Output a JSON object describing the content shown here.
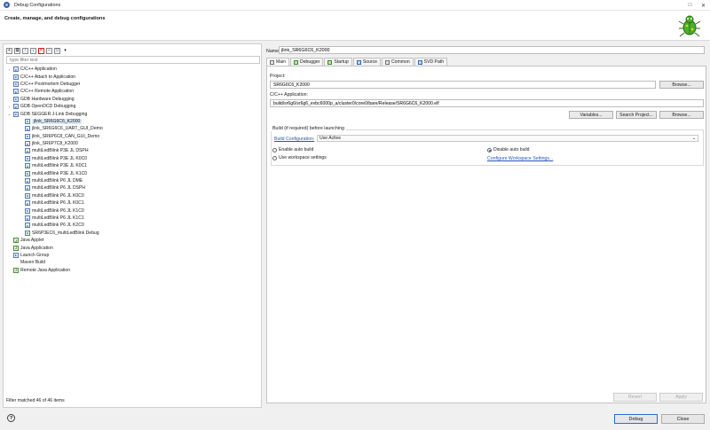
{
  "window": {
    "title": "Debug Configurations",
    "controls": [
      "□",
      "✕"
    ]
  },
  "banner": {
    "title": "Create, manage, and debug configurations"
  },
  "left": {
    "filter_placeholder": "type filter text",
    "status": "Filter matched 46 of 46 items",
    "toolbar": [
      "new-config-icon",
      "duplicate-icon",
      "export-icon",
      "import-icon",
      "delete-icon",
      "collapse-all-icon",
      "filter-icon",
      "dropdown-icon"
    ],
    "tree": [
      {
        "label": "C/C++ Application",
        "level": 0,
        "twist": "›",
        "icon": "c-icon"
      },
      {
        "label": "C/C++ Attach to Application",
        "level": 0,
        "twist": "",
        "icon": "c-icon"
      },
      {
        "label": "C/C++ Postmortem Debugger",
        "level": 0,
        "twist": "",
        "icon": "c-icon"
      },
      {
        "label": "C/C++ Remote Application",
        "level": 0,
        "twist": "",
        "icon": "c-icon"
      },
      {
        "label": "GDB Hardware Debugging",
        "level": 0,
        "twist": "",
        "icon": "c-icon"
      },
      {
        "label": "GDB OpenOCD Debugging",
        "level": 0,
        "twist": "›",
        "icon": "c-icon"
      },
      {
        "label": "GDB SEGGER J-Link Debugging",
        "level": 0,
        "twist": "⌄",
        "icon": "c-icon"
      },
      {
        "label": "jlink_SR6G6C6_K2000",
        "level": 1,
        "twist": "",
        "icon": "c-icon",
        "selected": true
      },
      {
        "label": "jlink_SR6G6C6_UART_GUI_Demo",
        "level": 1,
        "twist": "",
        "icon": "c-icon"
      },
      {
        "label": "jlink_SR6P6C8_CAN_GUI_Demo",
        "level": 1,
        "twist": "",
        "icon": "c-icon"
      },
      {
        "label": "jlink_SR6P7C8_K2000",
        "level": 1,
        "twist": "",
        "icon": "c-icon"
      },
      {
        "label": "multiLedBlink P3E JL DSPH",
        "level": 1,
        "twist": "",
        "icon": "c-icon"
      },
      {
        "label": "multiLedBlink P3E JL K0C0",
        "level": 1,
        "twist": "",
        "icon": "c-icon"
      },
      {
        "label": "multiLedBlink P3E JL K0C1",
        "level": 1,
        "twist": "",
        "icon": "c-icon"
      },
      {
        "label": "multiLedBlink P3E JL K1C0",
        "level": 1,
        "twist": "",
        "icon": "c-icon"
      },
      {
        "label": "multiLedBlink P6 JL DME",
        "level": 1,
        "twist": "",
        "icon": "c-icon"
      },
      {
        "label": "multiLedBlink P6 JL DSPH",
        "level": 1,
        "twist": "",
        "icon": "c-icon"
      },
      {
        "label": "multiLedBlink P6 JL K0C0",
        "level": 1,
        "twist": "",
        "icon": "c-icon"
      },
      {
        "label": "multiLedBlink P6 JL K0C1",
        "level": 1,
        "twist": "",
        "icon": "c-icon"
      },
      {
        "label": "multiLedBlink P6 JL K1C0",
        "level": 1,
        "twist": "",
        "icon": "c-icon"
      },
      {
        "label": "multiLedBlink P6 JL K1C1",
        "level": 1,
        "twist": "",
        "icon": "c-icon"
      },
      {
        "label": "multiLedBlink P6 JL K2C0",
        "level": 1,
        "twist": "",
        "icon": "c-icon"
      },
      {
        "label": "SR6P3EC6_multiLedBlink Debug",
        "level": 1,
        "twist": "",
        "icon": "c-icon"
      },
      {
        "label": "Java Applet",
        "level": 0,
        "twist": "",
        "icon": "java-icon"
      },
      {
        "label": "Java Application",
        "level": 0,
        "twist": "",
        "icon": "java-icon"
      },
      {
        "label": "Launch Group",
        "level": 0,
        "twist": "",
        "icon": "launch-group-icon"
      },
      {
        "label": "Maven Build",
        "level": 0,
        "twist": "",
        "icon": "maven-icon"
      },
      {
        "label": "Remote Java Application",
        "level": 0,
        "twist": "",
        "icon": "java-icon"
      }
    ]
  },
  "right": {
    "name_label": "Name:",
    "name_value": "jlink_SR6G6C6_K2000",
    "tabs": [
      {
        "label": "Main",
        "icon": "main-tab-icon",
        "active": true
      },
      {
        "label": "Debugger",
        "icon": "debugger-tab-icon"
      },
      {
        "label": "Startup",
        "icon": "startup-tab-icon"
      },
      {
        "label": "Source",
        "icon": "source-tab-icon"
      },
      {
        "label": "Common",
        "icon": "common-tab-icon"
      },
      {
        "label": "SVD Path",
        "icon": "svd-tab-icon"
      }
    ],
    "project_label": "Project:",
    "project_value": "SR6G6C6_K2000",
    "browse_label": "Browse...",
    "app_label": "C/C++ Application:",
    "app_value": "build/sr6g6/sr6g6_evbc6000p_a/cluster0/core0/bare/Release/SR6G6C6_K2000.elf",
    "variables_label": "Variables...",
    "search_project_label": "Search Project...",
    "browse2_label": "Browse...",
    "build_group_title": "Build (if required) before launching",
    "build_config_link": "Build Configuration:",
    "build_config_value": "Use Active",
    "enable_auto_build": "Enable auto build",
    "disable_auto_build": "Disable auto build",
    "use_workspace": "Use workspace settings",
    "configure_workspace": "Configure Workspace Settings...",
    "revert_label": "Revert",
    "apply_label": "Apply"
  },
  "footer": {
    "help": "?",
    "debug_label": "Debug",
    "close_label": "Close"
  }
}
